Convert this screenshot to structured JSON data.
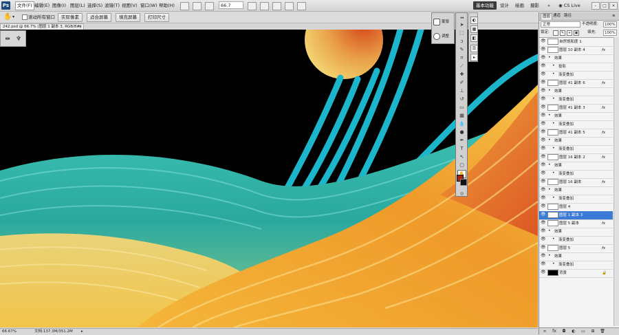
{
  "app": {
    "logo": "Ps"
  },
  "menu": [
    "文件(F)",
    "编辑(E)",
    "图像(I)",
    "图层(L)",
    "选择(S)",
    "滤镜(T)",
    "视图(V)",
    "窗口(W)",
    "帮助(H)"
  ],
  "zoom": "66.7",
  "workspace": {
    "active": "基本功能",
    "items": [
      "设计",
      "绘画",
      "摄影"
    ],
    "more": "»"
  },
  "cs_live": "CS Live",
  "options": {
    "scroll_all": "滚动所有窗口",
    "buttons": [
      "实际像素",
      "适合屏幕",
      "填充屏幕",
      "打印尺寸"
    ]
  },
  "document": {
    "tab": "242.psd @ 66.7% (图层 1 副本 3, RGB/8#)",
    "close": "×"
  },
  "status": {
    "zoom": "66.67%",
    "doc": "文档:137.3M/351.2M"
  },
  "adjust_panel": {
    "items": [
      "蒙版",
      "调整"
    ]
  },
  "colors": {
    "foreground": "#a6260e",
    "background": "#111111",
    "selection": "#3b7bd6"
  },
  "layers": {
    "tabs": [
      "图层",
      "通道",
      "路径"
    ],
    "blend_mode": "正常",
    "opacity_label": "不透明度:",
    "opacity": "100%",
    "lock_label": "锁定:",
    "fill_label": "填充:",
    "fill": "100%",
    "rows": [
      {
        "kind": "layer",
        "name": "自然饱和度 1",
        "fx": ""
      },
      {
        "kind": "layer",
        "name": "图层 10 副本 4",
        "fx": "fx"
      },
      {
        "kind": "effect",
        "name": "效果"
      },
      {
        "kind": "effect2",
        "name": "投影"
      },
      {
        "kind": "effect2",
        "name": "渐变叠加"
      },
      {
        "kind": "layer",
        "name": "图层 41 副本 6",
        "fx": "fx"
      },
      {
        "kind": "effect",
        "name": "效果"
      },
      {
        "kind": "effect2",
        "name": "渐变叠加"
      },
      {
        "kind": "layer",
        "name": "图层 41 副本 3",
        "fx": "fx"
      },
      {
        "kind": "effect",
        "name": "效果"
      },
      {
        "kind": "effect2",
        "name": "渐变叠加"
      },
      {
        "kind": "layer",
        "name": "图层 41 副本 5",
        "fx": "fx"
      },
      {
        "kind": "effect",
        "name": "效果"
      },
      {
        "kind": "effect2",
        "name": "渐变叠加"
      },
      {
        "kind": "layer",
        "name": "图层 16 副本 2",
        "fx": "fx"
      },
      {
        "kind": "effect",
        "name": "效果"
      },
      {
        "kind": "effect2",
        "name": "渐变叠加"
      },
      {
        "kind": "layer",
        "name": "图层 16 副本",
        "fx": "fx"
      },
      {
        "kind": "effect",
        "name": "效果"
      },
      {
        "kind": "effect2",
        "name": "渐变叠加"
      },
      {
        "kind": "layer",
        "name": "图层 4",
        "fx": ""
      },
      {
        "kind": "layer",
        "name": "图层 1 副本 3",
        "fx": "",
        "selected": true
      },
      {
        "kind": "layer",
        "name": "图层 5 副本",
        "fx": "fx"
      },
      {
        "kind": "effect",
        "name": "效果"
      },
      {
        "kind": "effect2",
        "name": "渐变叠加"
      },
      {
        "kind": "layer",
        "name": "图层 5",
        "fx": "fx"
      },
      {
        "kind": "effect",
        "name": "效果"
      },
      {
        "kind": "effect2",
        "name": "渐变叠加"
      },
      {
        "kind": "layer",
        "name": "背景",
        "fx": "",
        "locked": true
      }
    ]
  }
}
